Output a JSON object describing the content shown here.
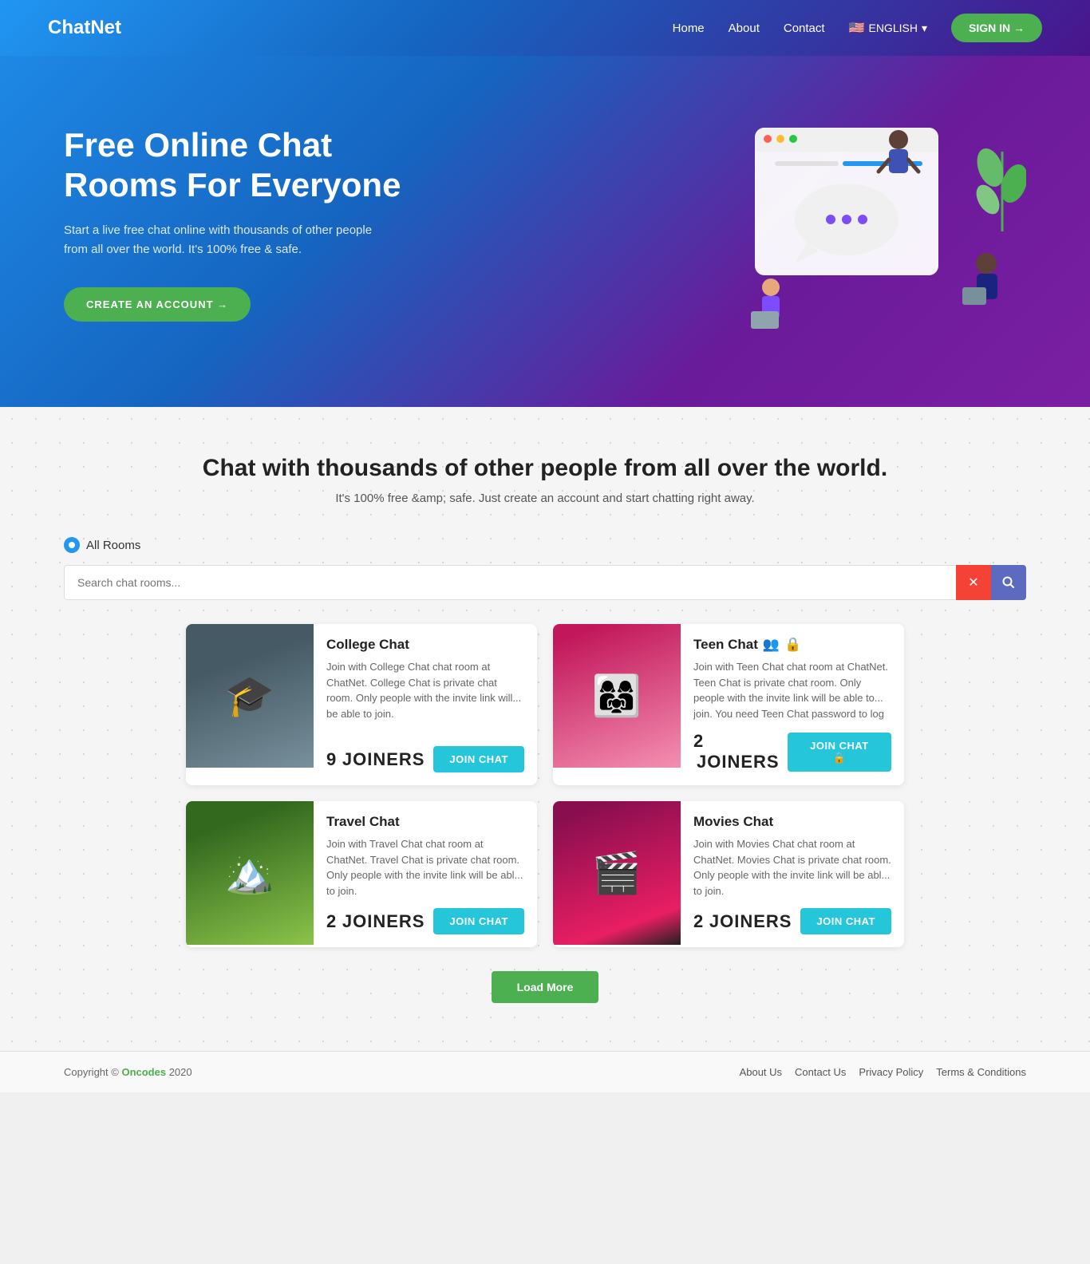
{
  "nav": {
    "logo_bold": "Chat",
    "logo_light": "Net",
    "links": [
      "Home",
      "About",
      "Contact"
    ],
    "lang_flag": "🇺🇸",
    "lang_label": "ENGLISH",
    "signin_label": "SIGN IN →"
  },
  "hero": {
    "title": "Free Online Chat Rooms For Everyone",
    "subtitle": "Start a live free chat online with thousands of other people from all over the world. It's 100% free & safe.",
    "cta_label": "CREATE AN ACCOUNT →"
  },
  "section": {
    "title": "Chat with thousands of other people from all over the world.",
    "subtitle": "It's 100% free &amp; safe. Just create an account and start chatting right away.",
    "tab_label": "All Rooms",
    "search_placeholder": "Search chat rooms...",
    "load_more_label": "Load More"
  },
  "rooms": [
    {
      "id": "college",
      "name": "College Chat",
      "desc": "Join with College Chat chat room at ChatNet. College Chat is private chat room. Only people with the invite link will... be able to join.",
      "joiners": "9",
      "joiners_label": "JOINERS",
      "join_label": "JOIN CHAT",
      "locked": false,
      "scene": "🎓"
    },
    {
      "id": "teen",
      "name": "Teen Chat",
      "desc": "Join with Teen Chat chat room at ChatNet. Teen Chat is private chat room. Only people with the invite link will be able to... join. You need Teen Chat password to log",
      "joiners": "2",
      "joiners_label": "JOINERS",
      "join_label": "JOIN CHAT",
      "locked": true,
      "scene": "👥"
    },
    {
      "id": "travel",
      "name": "Travel Chat",
      "desc": "Join with Travel Chat chat room at ChatNet. Travel Chat is private chat room. Only people with the invite link will be abl... to join.",
      "joiners": "2",
      "joiners_label": "JOINERS",
      "join_label": "JOIN CHAT",
      "locked": false,
      "scene": "🏔️"
    },
    {
      "id": "movies",
      "name": "Movies Chat",
      "desc": "Join with Movies Chat chat room at ChatNet. Movies Chat is private chat room. Only people with the invite link will be abl... to join.",
      "joiners": "2",
      "joiners_label": "JOINERS",
      "join_label": "JOIN CHAT",
      "locked": false,
      "scene": "🎬"
    }
  ],
  "footer": {
    "copy": "Copyright © Oncodes 2020",
    "copy_link": "Oncodes",
    "links": [
      "About Us",
      "Contact Us",
      "Privacy Policy",
      "Terms & Conditions"
    ]
  }
}
